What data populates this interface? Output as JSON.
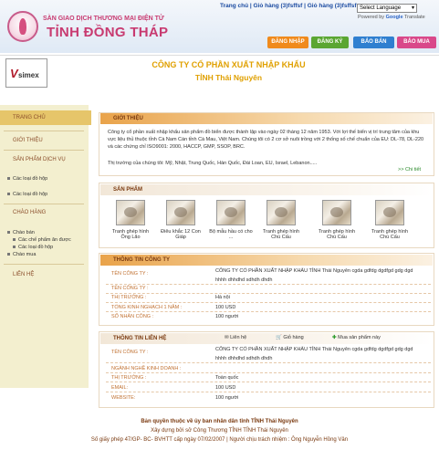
{
  "header": {
    "site_subtitle": "SÀN GIAO DỊCH THƯƠNG MẠI ĐIỆN TỬ",
    "site_title": "TỈNH ĐỒNG THÁP",
    "top_links": [
      "Trang chủ",
      "Giỏ hàng (3)fsffsf",
      "Giỏ hàng (3)fsffsf"
    ],
    "language_select": "Select Language",
    "powered_by": "Powered by",
    "google": "Google",
    "translate": "Translate",
    "nav": [
      {
        "label": "ĐĂNG NHẬP",
        "color": "#f08a1c"
      },
      {
        "label": "ĐĂNG KÝ",
        "color": "#5aa632"
      },
      {
        "label": "BẢO BÁN",
        "color": "#2f7fd0"
      },
      {
        "label": "BẢO MUA",
        "color": "#d9488a"
      }
    ]
  },
  "company": {
    "logo_text": "simex",
    "name": "CÔNG TY CỔ PHẦN XUẤT NHẬP KHẨU",
    "sub": "TỈNH Thái Nguyên"
  },
  "sidebar": {
    "items": [
      "TRANG CHỦ",
      "GIỚI THIỆU",
      "SẢN PHẨM DỊCH VỤ",
      "CHÀO HÀNG",
      "LIÊN HỆ"
    ],
    "sp_subs": [
      "Các loại đồ hộp",
      "Các loại đồ hộp"
    ],
    "ch_subs": [
      "Chào bán",
      "Các chế phẩm ăn được",
      "Các loại đồ hộp",
      "Chào mua"
    ]
  },
  "intro": {
    "title": "GIỚI THIỆU",
    "p1": "Công ty cổ phần xuất nhập khẩu sản phẩm đồ biển được thành lập vào ngày 02 tháng 12 năm 1953. Với lợi thế biển vị trí trung tâm của khu vực liệu thủ thuộc tỉnh Cà Nam Cán tỉnh Cà Mau, Việt Nam. Chúng tôi có 2 cơ sở nuôi trồng với 2 thống số chế chuẩn của EU: DL-78, DL-220 và các chứng chỉ ISO9001: 2000, HACCP, GMP, SSOP, BRC.",
    "p2": "Thị trường của chúng tôi: Mỹ, Nhật, Trung Quốc, Hàn Quốc, Đài Loan, EU, Israel, Lebanon.....",
    "more": ">> Chi tiết"
  },
  "products": {
    "title": "SẢN PHẨM",
    "items": [
      "Tranh ghép hình Ông Lão",
      "Điêu khắc 12 Con Giáp",
      "Bộ mẫu hầu có cho ...",
      "Tranh ghép hình Chú Cấu",
      "Tranh ghép hình Chú Cấu",
      "Tranh ghép hình Chú Cấu"
    ]
  },
  "company_info": {
    "title": "THÔNG TIN CÔNG TY",
    "rows": [
      {
        "label": "TÊN CÔNG TY :",
        "value": "CÔNG TY CỔ PHẦN XUẤT NHẬP KHẨU TỈNH Thái Nguyên cgda gdfdg dgdfgd gdg dgd"
      },
      {
        "label": "",
        "value": "hhhh dhhdhd sdhdh dhdh"
      },
      {
        "label": "TÊN CÔNG TY :",
        "value": ""
      },
      {
        "label": "THỊ TRƯỜNG :",
        "value": "Hà nội"
      },
      {
        "label": "TỔNG KINH NGHẠCH 1 NĂM :",
        "value": "100 USD"
      },
      {
        "label": "SỐ NHÂN CÔNG :",
        "value": "100 người"
      }
    ]
  },
  "contact": {
    "title": "THÔNG TIN LIÊN HỆ",
    "tabs": [
      "Liên hệ",
      "Giỏ hàng",
      "Mua sản phẩm này"
    ],
    "rows": [
      {
        "label": "TÊN CÔNG TY :",
        "value": "CÔNG TY CỔ PHẦN XUẤT NHẬP KHẨU TỈNH Thái Nguyên cgda gdfdg dgdfgd gdg dgd"
      },
      {
        "label": "",
        "value": "hhhh dhhdhd sdhdh dhdh"
      },
      {
        "label": "NGÀNH NGHỀ KINH DOANH :",
        "value": ""
      },
      {
        "label": "THỊ TRƯỜNG :",
        "value": "Toàn quốc"
      },
      {
        "label": "EMAIL:",
        "value": "100 USD"
      },
      {
        "label": "WEBSITE:",
        "value": "100 người"
      }
    ]
  },
  "footer": {
    "line1": "Bản quyền thuộc về ủy ban nhân dân tỉnh TỈNH Thái Nguyên",
    "line2": "Xây dựng bởi sở Công Thương TỈNH TỈNH Thái Nguyên",
    "line3": "Số giấy phép 47/GP- BC- BVHTT cấp ngày 07/02/2007 | Người chịu trách nhiệm : Ông Nguyễn Hồng Vân"
  }
}
